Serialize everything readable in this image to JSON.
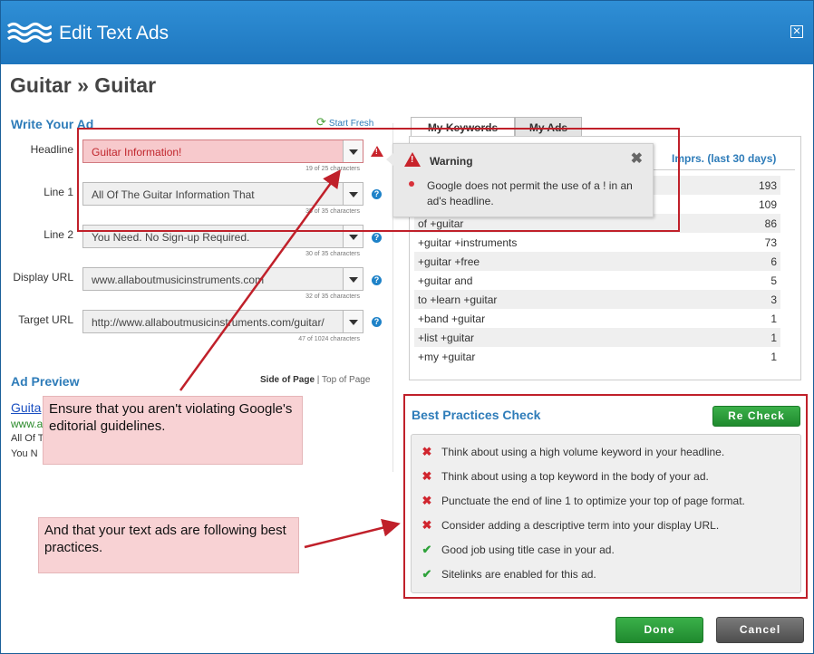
{
  "window": {
    "title": "Edit Text Ads"
  },
  "page_title": "Guitar » Guitar",
  "write_ad": {
    "section_title": "Write Your Ad",
    "start_fresh_label": "Start Fresh",
    "fields": [
      {
        "label": "Headline",
        "value": "Guitar Information!",
        "count": "19 of 25 characters"
      },
      {
        "label": "Line 1",
        "value": "All Of The Guitar Information That",
        "count": "35 of 35 characters"
      },
      {
        "label": "Line 2",
        "value": "You Need. No Sign-up Required.",
        "count": "30 of 35 characters"
      },
      {
        "label": "Display URL",
        "value": "www.allaboutmusicinstruments.com",
        "count": "32 of 35 characters"
      },
      {
        "label": "Target URL",
        "value": "http://www.allaboutmusicinstruments.com/guitar/",
        "count": "47 of 1024 characters"
      }
    ],
    "help_glyph": "?"
  },
  "tabs": {
    "my_keywords": "My Keywords",
    "my_ads": "My Ads"
  },
  "keywords": {
    "impressions_header": "Imprs. (last 30 days)",
    "rows": [
      {
        "keyword": "",
        "imprs": "193"
      },
      {
        "keyword": "",
        "imprs": "109"
      },
      {
        "keyword": "of +guitar",
        "imprs": "86"
      },
      {
        "keyword": "+guitar +instruments",
        "imprs": "73"
      },
      {
        "keyword": "+guitar +free",
        "imprs": "6"
      },
      {
        "keyword": "+guitar and",
        "imprs": "5"
      },
      {
        "keyword": "to +learn +guitar",
        "imprs": "3"
      },
      {
        "keyword": "+band +guitar",
        "imprs": "1"
      },
      {
        "keyword": "+list +guitar",
        "imprs": "1"
      },
      {
        "keyword": "+my +guitar",
        "imprs": "1"
      }
    ]
  },
  "warning": {
    "title": "Warning",
    "message": "Google does not permit the use of a ! in an ad's headline.",
    "close": "✖"
  },
  "ad_preview": {
    "section_title": "Ad Preview",
    "side_of_page": "Side of Page",
    "separator": "|",
    "top_of_page": "Top of Page",
    "title": "Guita",
    "url": "www.a",
    "line1": "All Of T",
    "line2": "You N"
  },
  "callouts": {
    "editorial": "Ensure that you aren't violating Google's editorial guidelines.",
    "best_practices": "And that your text ads are following best practices."
  },
  "best_practices": {
    "title": "Best Practices Check",
    "recheck_label": "Re Check",
    "items": [
      {
        "status": "fail",
        "icon": "✖",
        "text": "Think about using a high volume keyword in your headline."
      },
      {
        "status": "fail",
        "icon": "✖",
        "text": "Think about using a top keyword in the body of your ad."
      },
      {
        "status": "fail",
        "icon": "✖",
        "text": "Punctuate the end of line 1 to optimize your top of page format."
      },
      {
        "status": "fail",
        "icon": "✖",
        "text": "Consider adding a descriptive term into your display URL."
      },
      {
        "status": "pass",
        "icon": "✔",
        "text": "Good job using title case in your ad."
      },
      {
        "status": "pass",
        "icon": "✔",
        "text": "Sitelinks are enabled for this ad."
      }
    ]
  },
  "footer": {
    "done_label": "Done",
    "cancel_label": "Cancel"
  },
  "colors": {
    "brand": "#1e76be",
    "accent": "#2e7cb9",
    "error": "#c8232b",
    "success": "#2fa23b"
  }
}
